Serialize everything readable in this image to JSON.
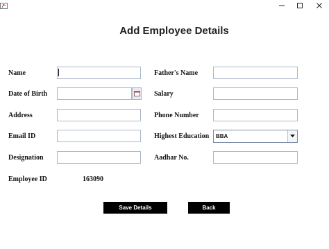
{
  "window": {
    "icons": {
      "app": "java-app-icon",
      "minimize": "minimize-icon",
      "maximize": "maximize-icon",
      "close": "close-icon"
    }
  },
  "form": {
    "title": "Add Employee Details",
    "fields": {
      "name": {
        "label": "Name",
        "value": ""
      },
      "dob": {
        "label": "Date of Birth",
        "value": ""
      },
      "address": {
        "label": "Address",
        "value": ""
      },
      "email": {
        "label": "Email ID",
        "value": ""
      },
      "designation": {
        "label": "Designation",
        "value": ""
      },
      "employee_id": {
        "label": "Employee ID",
        "value": "163090"
      },
      "father_name": {
        "label": "Father's Name",
        "value": ""
      },
      "salary": {
        "label": "Salary",
        "value": ""
      },
      "phone": {
        "label": "Phone Number",
        "value": ""
      },
      "education": {
        "label": "Highest Education",
        "selected": "BBA"
      },
      "aadhar": {
        "label": "Aadhar No.",
        "value": ""
      }
    },
    "buttons": {
      "save": "Save Details",
      "back": "Back"
    }
  }
}
